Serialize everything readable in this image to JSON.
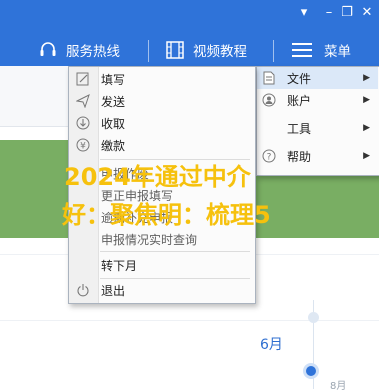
{
  "header": {
    "window_controls": [
      "▾",
      "–",
      "❐",
      "✕"
    ],
    "service_hotline": "服务热线",
    "video_tutorial": "视频教程",
    "menu": "菜单"
  },
  "main_menu": {
    "items": [
      {
        "label": "填写",
        "icon": "edit-icon"
      },
      {
        "label": "发送",
        "icon": "send-icon"
      },
      {
        "label": "收取",
        "icon": "receive-icon"
      },
      {
        "label": "缴款",
        "icon": "payment-icon"
      },
      {
        "label": "申报作废",
        "icon": ""
      },
      {
        "label": "更正申报填写",
        "icon": ""
      },
      {
        "label": "逾期补充申报",
        "icon": ""
      },
      {
        "label": "申报情况实时查询",
        "icon": ""
      },
      {
        "label": "转下月",
        "icon": ""
      },
      {
        "label": "退出",
        "icon": "power-icon"
      }
    ]
  },
  "sub_menu": {
    "items": [
      {
        "label": "文件",
        "icon": "file-icon"
      },
      {
        "label": "账户",
        "icon": "user-icon"
      },
      {
        "label": "工具",
        "icon": ""
      },
      {
        "label": "帮助",
        "icon": "help-icon"
      }
    ]
  },
  "timeline": {
    "month": "6月",
    "next_month": "8月"
  },
  "overlay": {
    "line1": "2024年通过中介",
    "line2": "好：聚焦明：梳理5"
  },
  "colors": {
    "header": "#2f73d9",
    "overlay_text": "#f6c10d",
    "banner": "#6fa857"
  }
}
